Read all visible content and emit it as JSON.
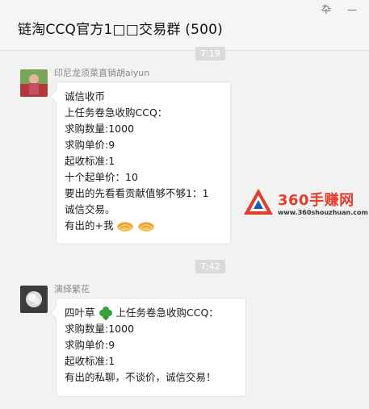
{
  "window": {
    "title": "链淘CCQ官方1□□交易群 (500)",
    "pin_icon": "pin-icon",
    "minimize_icon": "minimize-icon"
  },
  "messages": [
    {
      "time": "7:19",
      "sender": "印尼龙须菜直销胡aiyun",
      "lines": [
        "诚信收币",
        "上任务卷急收购CCQ：",
        "求购数量:1000",
        "求购单价:9",
        "起收标准:1",
        "十个起单价：10",
        "要出的先看看贡献值够不够1：1",
        "诚信交易。",
        "有出的+我"
      ]
    },
    {
      "time": "7:42",
      "sender": "演绎繁花",
      "first_line_prefix": "四叶草",
      "first_line_suffix": "上任务卷急收购CCQ：",
      "lines": [
        "求购数量:1000",
        "求购单价:9",
        "起收标准:1",
        "有出的私聊，不谈价，诚信交易！"
      ]
    }
  ],
  "watermark": {
    "brand": "360手赚网",
    "url": "www.360shouzhuan.com"
  },
  "colors": {
    "background": "#f2f2f2",
    "bubble": "#ffffff",
    "watermark": "#e53c2c"
  }
}
